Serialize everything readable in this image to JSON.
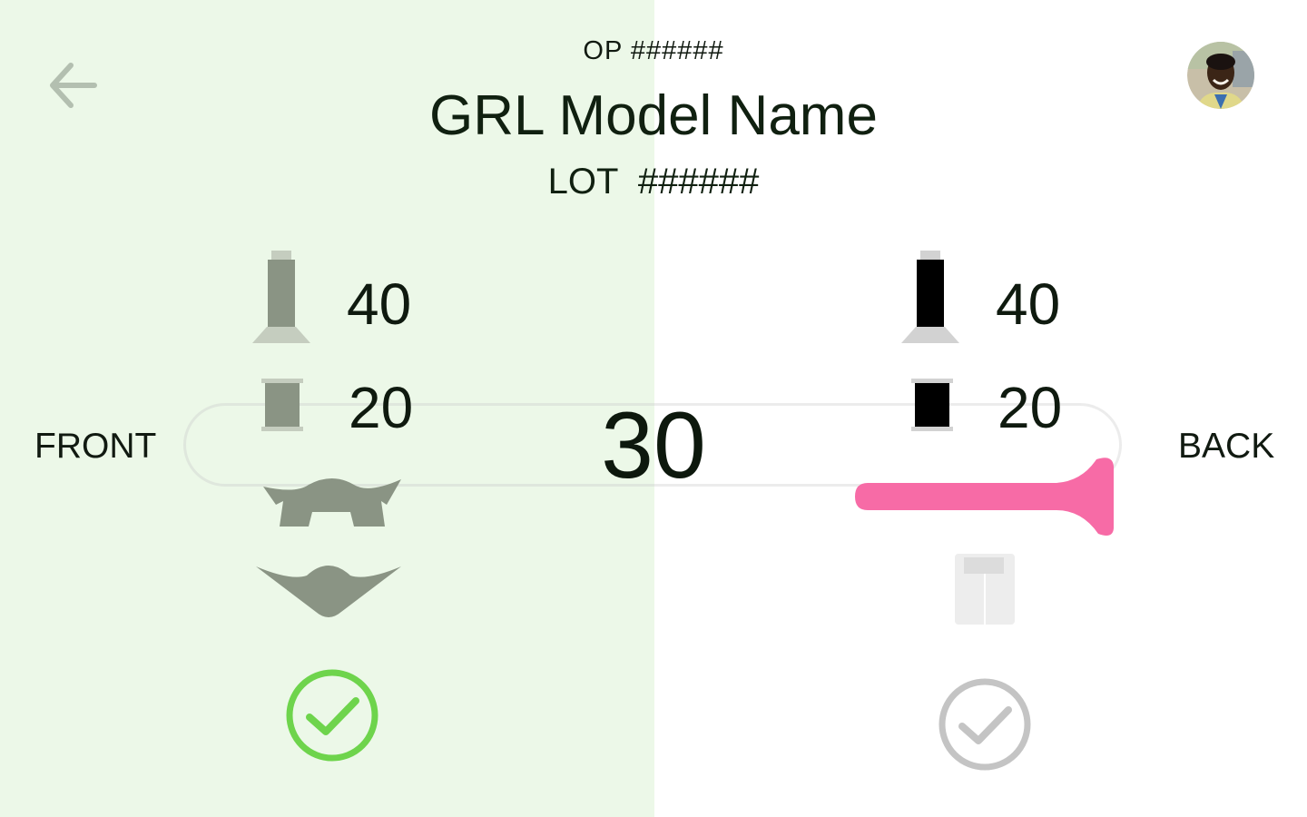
{
  "header": {
    "op_label": "OP ######",
    "model_name": "GRL Model Name",
    "lot_label": "LOT  ######"
  },
  "navigation": {
    "back_icon": "arrow-left-icon",
    "avatar_icon": "user-avatar"
  },
  "sides": {
    "front_label": "FRONT",
    "back_label": "BACK"
  },
  "center": {
    "count": "30"
  },
  "front": {
    "needle_thread_value": "40",
    "bobbin_thread_value": "20",
    "status": "complete",
    "status_icon": "check-circle-icon"
  },
  "back": {
    "needle_thread_value": "40",
    "bobbin_thread_value": "20",
    "status": "pending",
    "status_icon": "check-circle-icon"
  },
  "colors": {
    "front_panel_bg": "#ecf8e8",
    "front_icon_gray": "#8a9484",
    "back_icon_black": "#000000",
    "accent_pink": "#f76ba6",
    "check_green": "#6ed44c",
    "check_gray": "#c4c4c4",
    "back_arrow": "#b3bfb0"
  }
}
